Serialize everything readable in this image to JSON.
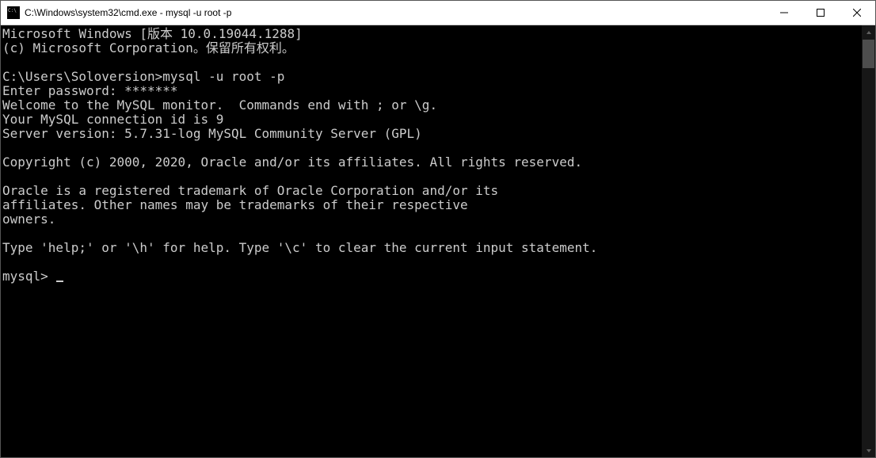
{
  "window": {
    "title": "C:\\Windows\\system32\\cmd.exe - mysql  -u root -p"
  },
  "terminal": {
    "lines": [
      "Microsoft Windows [版本 10.0.19044.1288]",
      "(c) Microsoft Corporation。保留所有权利。",
      "",
      "C:\\Users\\Soloversion>mysql -u root -p",
      "Enter password: *******",
      "Welcome to the MySQL monitor.  Commands end with ; or \\g.",
      "Your MySQL connection id is 9",
      "Server version: 5.7.31-log MySQL Community Server (GPL)",
      "",
      "Copyright (c) 2000, 2020, Oracle and/or its affiliates. All rights reserved.",
      "",
      "Oracle is a registered trademark of Oracle Corporation and/or its",
      "affiliates. Other names may be trademarks of their respective",
      "owners.",
      "",
      "Type 'help;' or '\\h' for help. Type '\\c' to clear the current input statement.",
      "",
      "mysql>"
    ]
  }
}
